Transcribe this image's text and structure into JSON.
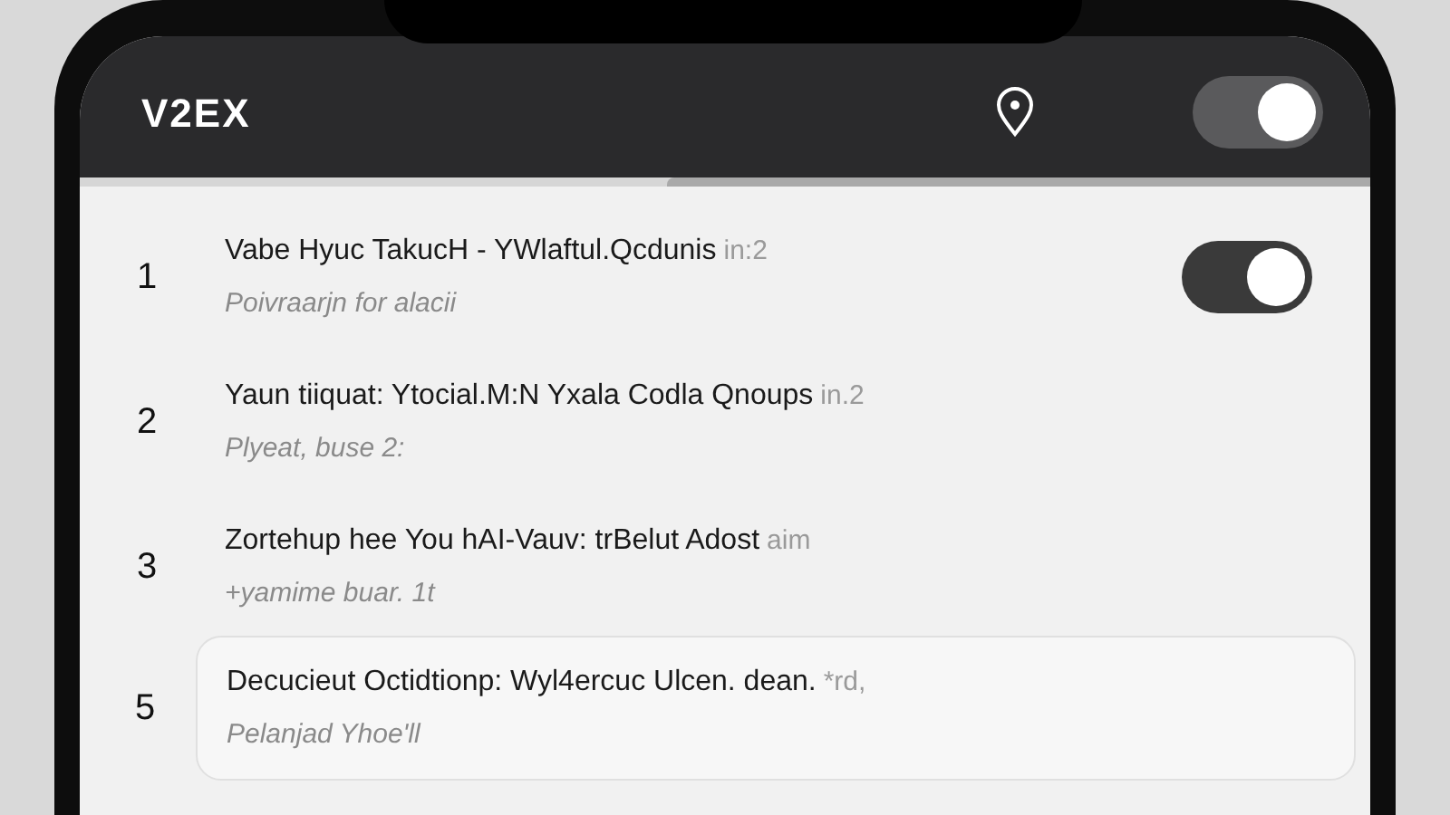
{
  "header": {
    "title": "V2EX",
    "toggle": {
      "on": true
    }
  },
  "topics": [
    {
      "number": "1",
      "title": "Vabe Hyuc TakucH - YWlaftul.Qcdunis",
      "meta": "in:2",
      "subtitle": "Poivraarjn for alacii",
      "card": false,
      "toggle": {
        "on": true
      }
    },
    {
      "number": "2",
      "title": "Yaun tiiquat: Ytocial.M:N Yxala Codla Qnoups",
      "meta": "in.2",
      "subtitle": "Plyeat, buse  2:",
      "card": false
    },
    {
      "number": "3",
      "title": "Zortehup hee You hAI-Vauv: trBelut Adost",
      "meta": "aim",
      "subtitle": "+yamime  buar. 1t",
      "card": false
    },
    {
      "number": "5",
      "title": "Decucieut Octidtionp: Wyl4ercuc Ulcen. dean.",
      "meta": "*rd,",
      "subtitle": "Pelanjad Yhoe'll",
      "card": true
    }
  ]
}
